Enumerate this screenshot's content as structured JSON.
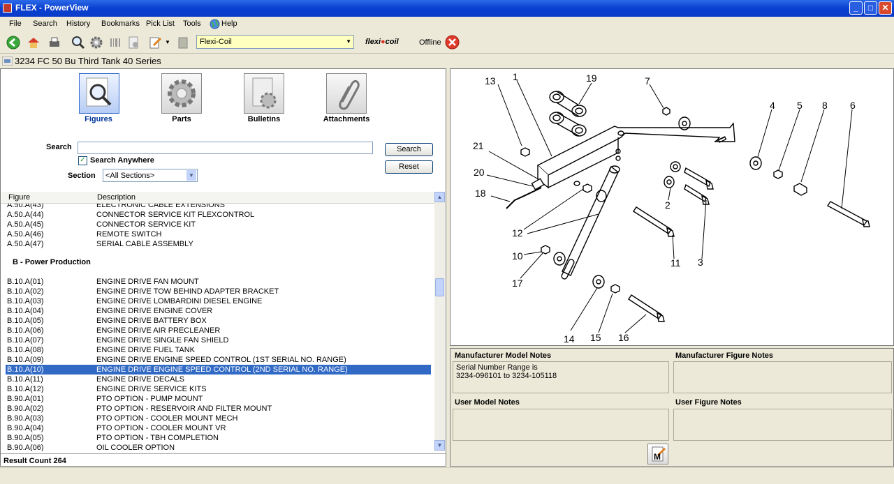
{
  "window": {
    "title": "FLEX - PowerView"
  },
  "menu": [
    "File",
    "Search",
    "History",
    "Bookmarks",
    "Pick List",
    "Tools",
    "Help"
  ],
  "toolbar": {
    "brand_combo": "Flexi-Coil",
    "brand_logo": "flexicoil",
    "status": "Offline"
  },
  "subheader": {
    "title": "3234 FC 50 Bu Third Tank 40 Series"
  },
  "nav": {
    "figures": "Figures",
    "parts": "Parts",
    "bulletins": "Bulletins",
    "attachments": "Attachments"
  },
  "search": {
    "label": "Search",
    "value": "",
    "search_anywhere": "Search Anywhere",
    "section_label": "Section",
    "section_value": "<All Sections>",
    "search_btn": "Search",
    "reset_btn": "Reset"
  },
  "list": {
    "headers": {
      "figure": "Figure",
      "description": "Description"
    },
    "partial_row": {
      "figure": "A.50.A(43)",
      "description": "ELECTRONIC CABLE EXTENSIONS"
    },
    "rows_a": [
      {
        "figure": "A.50.A(44)",
        "description": "CONNECTOR SERVICE KIT FLEXCONTROL"
      },
      {
        "figure": "A.50.A(45)",
        "description": "CONNECTOR SERVICE KIT"
      },
      {
        "figure": "A.50.A(46)",
        "description": "REMOTE SWITCH"
      },
      {
        "figure": "A.50.A(47)",
        "description": "SERIAL CABLE ASSEMBLY"
      }
    ],
    "group_b": "B - Power Production",
    "rows_b": [
      {
        "figure": "B.10.A(01)",
        "description": "ENGINE DRIVE FAN MOUNT"
      },
      {
        "figure": "B.10.A(02)",
        "description": "ENGINE DRIVE TOW BEHIND ADAPTER BRACKET"
      },
      {
        "figure": "B.10.A(03)",
        "description": "ENGINE DRIVE LOMBARDINI DIESEL ENGINE"
      },
      {
        "figure": "B.10.A(04)",
        "description": "ENGINE DRIVE ENGINE COVER"
      },
      {
        "figure": "B.10.A(05)",
        "description": "ENGINE DRIVE BATTERY BOX"
      },
      {
        "figure": "B.10.A(06)",
        "description": "ENGINE DRIVE AIR PRECLEANER"
      },
      {
        "figure": "B.10.A(07)",
        "description": "ENGINE DRIVE SINGLE FAN SHIELD"
      },
      {
        "figure": "B.10.A(08)",
        "description": "ENGINE DRIVE FUEL TANK"
      },
      {
        "figure": "B.10.A(09)",
        "description": "ENGINE DRIVE ENGINE SPEED CONTROL (1ST SERIAL NO. RANGE)"
      },
      {
        "figure": "B.10.A(10)",
        "description": "ENGINE DRIVE ENGINE SPEED CONTROL (2ND SERIAL NO. RANGE)"
      },
      {
        "figure": "B.10.A(11)",
        "description": "ENGINE DRIVE DECALS"
      },
      {
        "figure": "B.10.A(12)",
        "description": "ENGINE DRIVE SERVICE KITS"
      },
      {
        "figure": "B.90.A(01)",
        "description": "PTO OPTION - PUMP MOUNT"
      },
      {
        "figure": "B.90.A(02)",
        "description": "PTO OPTION - RESERVOIR AND FILTER MOUNT"
      },
      {
        "figure": "B.90.A(03)",
        "description": "PTO OPTION - COOLER MOUNT MECH"
      },
      {
        "figure": "B.90.A(04)",
        "description": "PTO OPTION - COOLER MOUNT VR"
      },
      {
        "figure": "B.90.A(05)",
        "description": "PTO OPTION - TBH COMPLETION"
      },
      {
        "figure": "B.90.A(06)",
        "description": "OIL COOLER OPTION"
      }
    ],
    "selected_figure": "B.10.A(10)",
    "result_count": "Result Count 264"
  },
  "diagram": {
    "callouts": [
      "13",
      "1",
      "19",
      "7",
      "4",
      "5",
      "8",
      "6",
      "21",
      "20",
      "18",
      "2",
      "12",
      "10",
      "11",
      "3",
      "17",
      "14",
      "15",
      "16"
    ]
  },
  "notes": {
    "manufacturer_model_title": "Manufacturer Model Notes",
    "manufacturer_model_line1": "Serial Number Range is",
    "manufacturer_model_line2": "3234-096101 to 3234-105118",
    "manufacturer_figure_title": "Manufacturer Figure Notes",
    "user_model_title": "User Model Notes",
    "user_figure_title": "User Figure Notes",
    "memo_button": "M"
  }
}
